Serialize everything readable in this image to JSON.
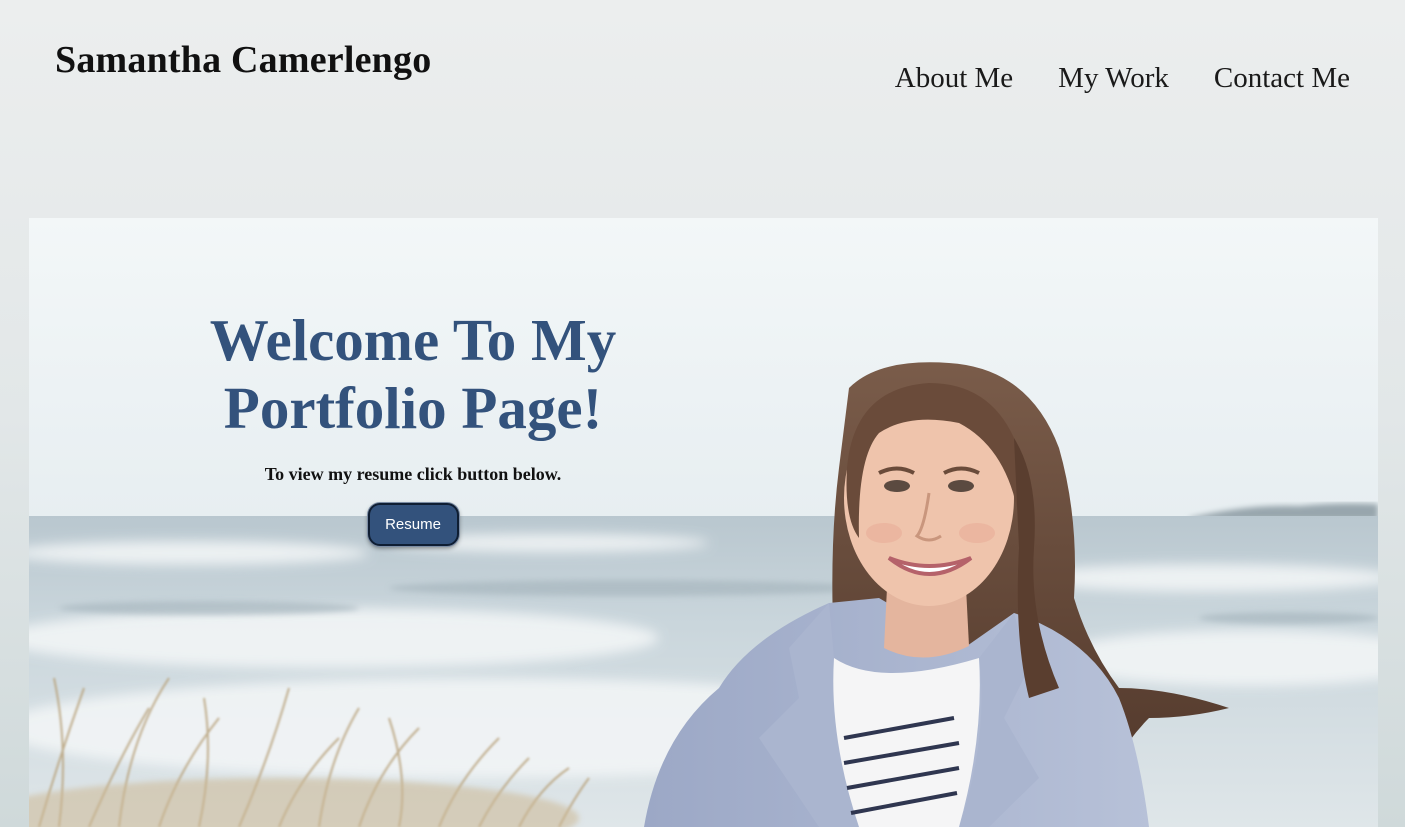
{
  "header": {
    "site_title": "Samantha Camerlengo",
    "nav": [
      {
        "label": "About Me"
      },
      {
        "label": "My Work"
      },
      {
        "label": "Contact Me"
      }
    ]
  },
  "hero": {
    "title_line1": "Welcome To My",
    "title_line2": "Portfolio Page!",
    "subtitle": "To view my resume click button below.",
    "button_label": "Resume"
  },
  "colors": {
    "accent": "#33527c",
    "page_background": "#e6eaeb",
    "text": "#111111"
  }
}
